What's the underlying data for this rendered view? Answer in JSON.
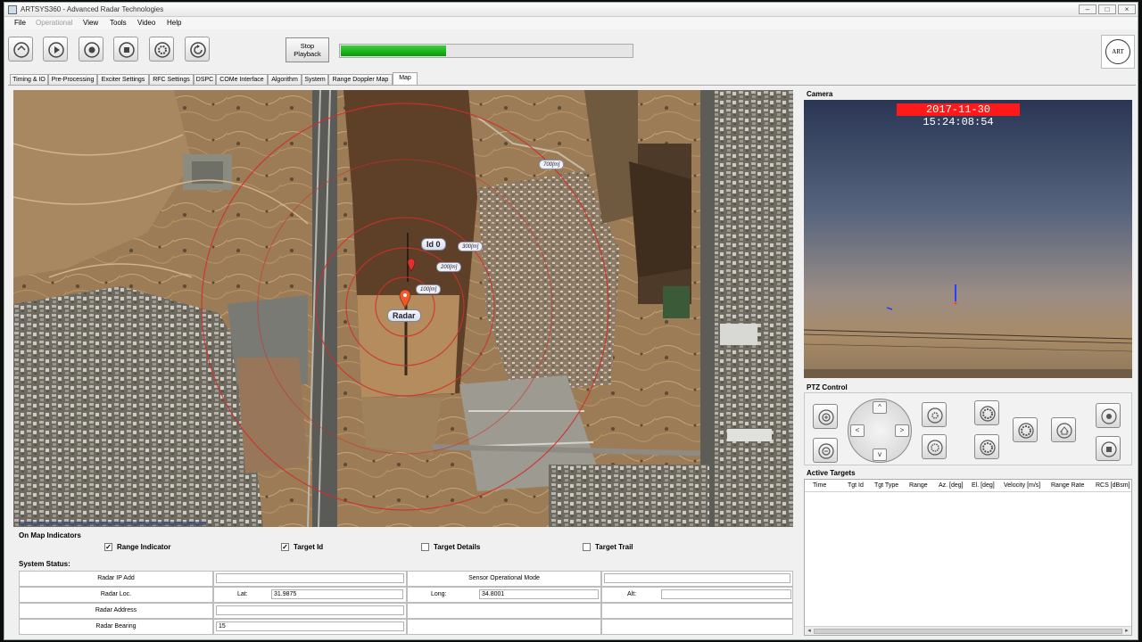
{
  "window": {
    "title": "ARTSYS360 - Advanced Radar Technologies",
    "controls": [
      "–",
      "□",
      "×"
    ]
  },
  "menu": [
    "File",
    "Operational",
    "View",
    "Tools",
    "Video",
    "Help"
  ],
  "toolbar": {
    "buttons": [
      "rotate-icon",
      "play-icon",
      "record-icon",
      "stop-icon",
      "gear-icon",
      "refresh-icon"
    ],
    "stop_playback_line1": "Stop",
    "stop_playback_line2": "Playback",
    "progress": 0.36
  },
  "logo": {
    "text": "ART"
  },
  "tabs": [
    "Timing & IO",
    "Pre-Processing",
    "Exciter Settings",
    "RFC Settings",
    "DSPC",
    "COMe Interface",
    "Algorithm",
    "System",
    "Range Doppler Map",
    "Map"
  ],
  "active_tab": "Map",
  "map": {
    "radar_label": "Radar",
    "target_label": "Id 0",
    "range_labels": [
      "100[m]",
      "200[m]",
      "300[m]",
      "700[m]"
    ]
  },
  "indicators": {
    "title": "On Map Indicators",
    "items": [
      {
        "label": "Range Indicator",
        "checked": true
      },
      {
        "label": "Target Id",
        "checked": true
      },
      {
        "label": "Target Details",
        "checked": false
      },
      {
        "label": "Target Trail",
        "checked": false
      }
    ]
  },
  "system_status": {
    "title": "System Status:",
    "radar_ip_label": "Radar IP Add",
    "radar_ip_value": "",
    "sensor_mode_label": "Sensor Operational Mode",
    "sensor_mode_value": "",
    "radar_loc_label": "Radar Loc.",
    "lat_label": "Lat:",
    "lat_value": "31.9875",
    "long_label": "Long:",
    "long_value": "34.8001",
    "alt_label": "Alt:",
    "alt_value": "",
    "radar_address_label": "Radar Address",
    "radar_address_value": "",
    "radar_bearing_label": "Radar Bearing",
    "radar_bearing_value": "15"
  },
  "camera": {
    "title": "Camera",
    "timestamp": "2017-11-30 15:24:08:54"
  },
  "ptz": {
    "title": "PTZ Control",
    "arrows": [
      "^",
      "<",
      ">",
      "v"
    ]
  },
  "active_targets": {
    "title": "Active Targets",
    "columns": [
      "Time",
      "Tgt Id",
      "Tgt Type",
      "Range",
      "Az. [deg]",
      "El. [deg]",
      "Velocity [m/s]",
      "Range Rate",
      "RCS [dBsm]"
    ],
    "rows": []
  },
  "colors": {
    "progress": "#12a312",
    "range_ring": "#d0302a",
    "timestamp_bg": "#ff1a1a"
  }
}
